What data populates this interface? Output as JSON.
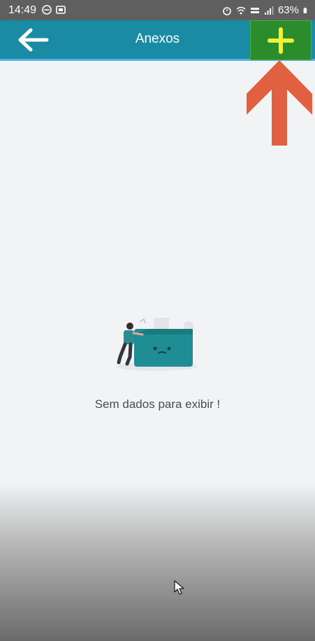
{
  "status_bar": {
    "time": "14:49",
    "battery": "63%",
    "icons": [
      "do-not-disturb-icon",
      "nfc-icon",
      "alarm-icon",
      "wifi-icon",
      "lte-icon",
      "signal-icon",
      "battery-icon"
    ]
  },
  "header": {
    "title": "Anexos",
    "back_icon": "arrow-left-icon",
    "add_icon": "plus-icon"
  },
  "empty_state": {
    "message": "Sem dados para exibir !",
    "illustration": "empty-folder-illustration"
  },
  "colors": {
    "app_bar": "#198ba4",
    "add_highlight": "#2a8c2a",
    "plus": "#f0f23a",
    "annotation_arrow": "#e0603f",
    "background": "#f2f3f5"
  }
}
